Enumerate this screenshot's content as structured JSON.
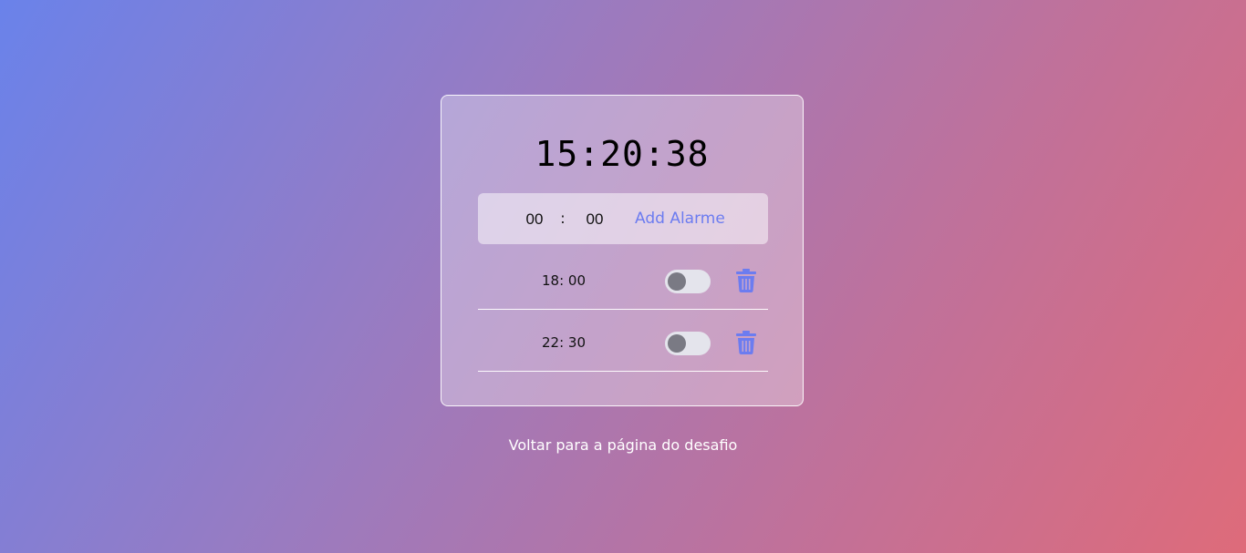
{
  "clock": {
    "time": "15:20:38"
  },
  "add_alarm": {
    "hour_value": "00",
    "separator": ":",
    "minute_value": "00",
    "button_label": "Add Alarme"
  },
  "alarms": [
    {
      "time": "18: 00",
      "enabled": false
    },
    {
      "time": "22: 30",
      "enabled": false
    }
  ],
  "footer": {
    "back_link": "Voltar para a página do desafio"
  },
  "colors": {
    "accent": "#6c7cf0",
    "toggle_off_track": "#e4e4ec",
    "toggle_off_knob": "#7a7a84"
  },
  "icons": {
    "delete": "trash-icon"
  }
}
